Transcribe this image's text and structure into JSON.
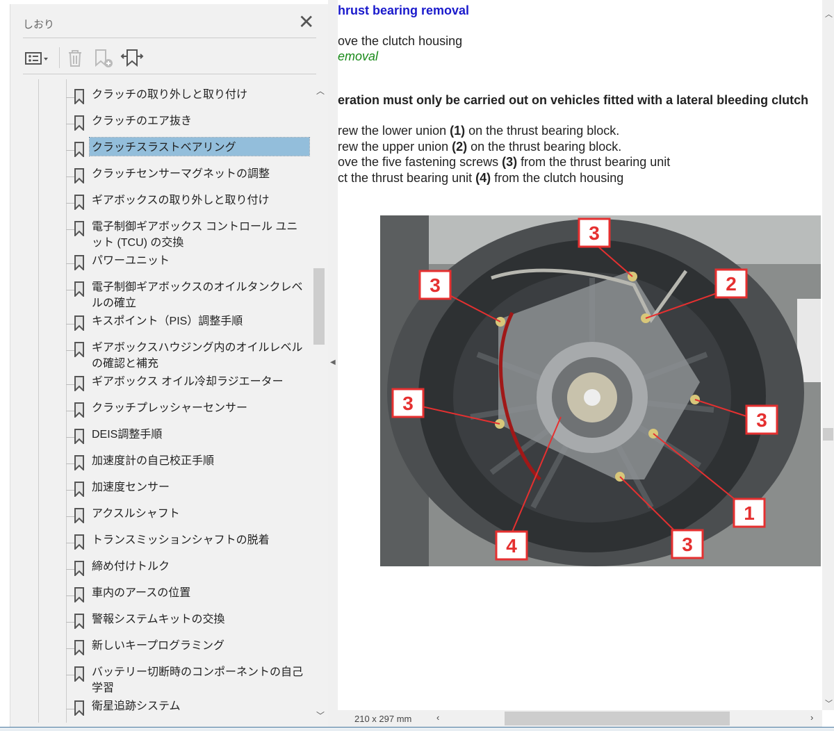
{
  "bookmarks_panel": {
    "title": "しおり",
    "items": [
      {
        "label": "クラッチの取り外しと取り付け"
      },
      {
        "label": "クラッチのエア抜き"
      },
      {
        "label": "クラッチスラストベアリング",
        "selected": true
      },
      {
        "label": "クラッチセンサーマグネットの調整"
      },
      {
        "label": "ギアボックスの取り外しと取り付け"
      },
      {
        "label": "電子制御ギアボックス コントロール ユニット (TCU) の交換"
      },
      {
        "label": "パワーユニット"
      },
      {
        "label": "電子制御ギアボックスのオイルタンクレベルの確立"
      },
      {
        "label": "キスポイント（PIS）調整手順"
      },
      {
        "label": "ギアボックスハウジング内のオイルレベルの確認と補充"
      },
      {
        "label": "ギアボックス オイル冷却ラジエーター"
      },
      {
        "label": "クラッチプレッシャーセンサー"
      },
      {
        "label": "DEIS調整手順"
      },
      {
        "label": "加速度計の自己校正手順"
      },
      {
        "label": "加速度センサー"
      },
      {
        "label": "アクスルシャフト"
      },
      {
        "label": "トランスミッションシャフトの脱着"
      },
      {
        "label": "締め付けトルク"
      },
      {
        "label": "車内のアースの位置"
      },
      {
        "label": "警報システムキットの交換"
      },
      {
        "label": "新しいキープログラミング"
      },
      {
        "label": "バッテリー切断時のコンポーネントの自己学習"
      },
      {
        "label": "衛星追跡システム"
      }
    ]
  },
  "document": {
    "heading": "hrust bearing removal",
    "line1": "ove the clutch housing",
    "link": "emoval",
    "warning": "eration must only be carried out on vehicles fitted with a lateral bleeding clutch",
    "steps": [
      {
        "pre": "rew the lower union ",
        "num": "(1)",
        "post": " on the thrust bearing block."
      },
      {
        "pre": "rew the upper union ",
        "num": "(2)",
        "post": " on the thrust bearing block."
      },
      {
        "pre": "ove the five fastening screws ",
        "num": "(3)",
        "post": " from the thrust bearing unit"
      },
      {
        "pre": "ct the thrust bearing unit ",
        "num": "(4)",
        "post": " from the clutch housing"
      }
    ],
    "callouts": [
      "3",
      "3",
      "2",
      "3",
      "3",
      "1",
      "4",
      "3"
    ]
  },
  "status": {
    "page_size": "210 x 297 mm"
  },
  "colors": {
    "heading": "#1a1acc",
    "link": "#1a8a1a",
    "selection": "#93bedb",
    "callout": "#e53030"
  }
}
